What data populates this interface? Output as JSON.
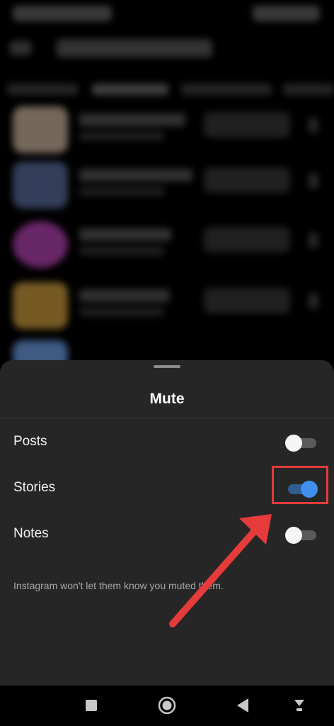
{
  "sheet": {
    "title": "Mute",
    "options": [
      {
        "label": "Posts",
        "enabled": false
      },
      {
        "label": "Stories",
        "enabled": true
      },
      {
        "label": "Notes",
        "enabled": false
      }
    ],
    "footnote": "Instagram won't let them know you muted them."
  },
  "navbar": {
    "icons": [
      "recent-apps-icon",
      "home-icon",
      "back-icon",
      "hide-keyboard-icon"
    ]
  },
  "colors": {
    "sheet_background": "#262626",
    "toggle_on": "#3f90ee",
    "annotation": "#e53b3b"
  }
}
